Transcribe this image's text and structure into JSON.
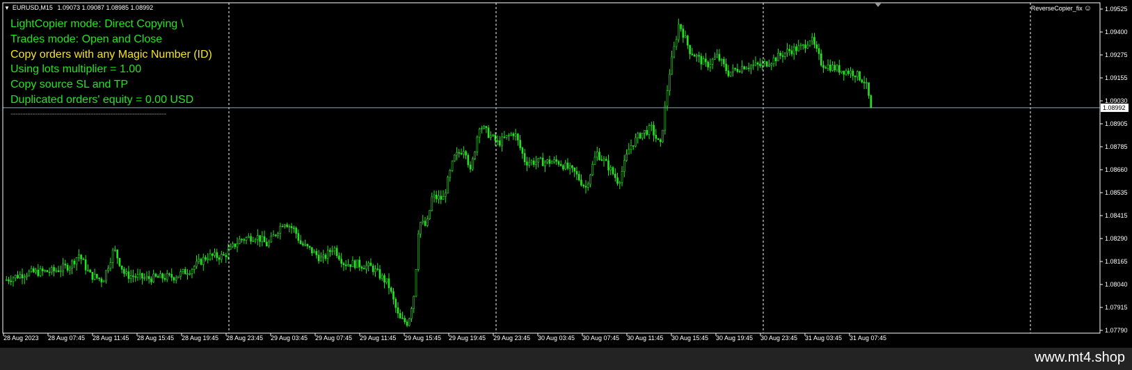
{
  "header": {
    "symbol": "EURUSD,M15",
    "ohlc": "1.09073 1.09087 1.08985 1.08992"
  },
  "overlay": {
    "lines": [
      {
        "text": "LightCopier mode: Direct Copying \\",
        "color": "green"
      },
      {
        "text": "Trades mode: Open and Close",
        "color": "green"
      },
      {
        "text": "Copy orders with any Magic Number (ID)",
        "color": "yellow"
      },
      {
        "text": "Using lots multiplier = 1.00",
        "color": "green"
      },
      {
        "text": "Copy source SL and TP",
        "color": "green"
      },
      {
        "text": "Duplicated orders' equity = 0.00 USD",
        "color": "green"
      }
    ],
    "separator": "----------------------------------------------------------------"
  },
  "expert": {
    "name": "ReverseCopier_fix",
    "icon": "smiley-icon"
  },
  "watermark": "www.mt4.shop",
  "colors": {
    "background": "#000000",
    "candle": "#22e61e",
    "grid": "#ffffff",
    "price_line": "#8fa8b8"
  },
  "chart_data": {
    "type": "candlestick",
    "current_price": "1.08992",
    "y_ticks": [
      "1.09525",
      "1.09400",
      "1.09275",
      "1.09155",
      "1.09030",
      "1.08905",
      "1.08785",
      "1.08660",
      "1.08535",
      "1.08415",
      "1.08290",
      "1.08165",
      "1.08040",
      "1.07915",
      "1.07790"
    ],
    "ylim": [
      1.0779,
      1.09525
    ],
    "x_ticks": [
      "28 Aug 2023",
      "28 Aug 07:45",
      "28 Aug 11:45",
      "28 Aug 15:45",
      "28 Aug 19:45",
      "28 Aug 23:45",
      "29 Aug 03:45",
      "29 Aug 07:45",
      "29 Aug 11:45",
      "29 Aug 15:45",
      "29 Aug 19:45",
      "29 Aug 23:45",
      "30 Aug 03:45",
      "30 Aug 07:45",
      "30 Aug 11:45",
      "30 Aug 15:45",
      "30 Aug 19:45",
      "30 Aug 23:45",
      "31 Aug 03:45",
      "31 Aug 07:45"
    ],
    "day_separators": 5,
    "close_path": [
      [
        0,
        1.0806
      ],
      [
        0.02,
        1.081
      ],
      [
        0.045,
        1.0811
      ],
      [
        0.06,
        1.0814
      ],
      [
        0.068,
        1.082
      ],
      [
        0.078,
        1.0809
      ],
      [
        0.09,
        1.0806
      ],
      [
        0.1,
        1.0823
      ],
      [
        0.11,
        1.0809
      ],
      [
        0.13,
        1.0807
      ],
      [
        0.155,
        1.0808
      ],
      [
        0.17,
        1.0812
      ],
      [
        0.185,
        1.0819
      ],
      [
        0.2,
        1.0819
      ],
      [
        0.215,
        1.0828
      ],
      [
        0.23,
        1.083
      ],
      [
        0.24,
        1.0825
      ],
      [
        0.255,
        1.0838
      ],
      [
        0.265,
        1.0833
      ],
      [
        0.27,
        1.0826
      ],
      [
        0.28,
        1.0822
      ],
      [
        0.29,
        1.0817
      ],
      [
        0.3,
        1.0824
      ],
      [
        0.31,
        1.0815
      ],
      [
        0.32,
        1.0815
      ],
      [
        0.335,
        1.0813
      ],
      [
        0.35,
        1.0804
      ],
      [
        0.36,
        1.0785
      ],
      [
        0.368,
        1.0783
      ],
      [
        0.374,
        1.08
      ],
      [
        0.378,
        1.0838
      ],
      [
        0.385,
        1.0835
      ],
      [
        0.39,
        1.0851
      ],
      [
        0.4,
        1.085
      ],
      [
        0.41,
        1.0872
      ],
      [
        0.42,
        1.0878
      ],
      [
        0.425,
        1.0864
      ],
      [
        0.433,
        1.089
      ],
      [
        0.45,
        1.088
      ],
      [
        0.465,
        1.0886
      ],
      [
        0.475,
        1.087
      ],
      [
        0.49,
        1.087
      ],
      [
        0.505,
        1.087
      ],
      [
        0.52,
        1.0864
      ],
      [
        0.53,
        1.0856
      ],
      [
        0.54,
        1.0875
      ],
      [
        0.55,
        1.0868
      ],
      [
        0.56,
        1.0859
      ],
      [
        0.57,
        1.0878
      ],
      [
        0.58,
        1.0885
      ],
      [
        0.59,
        1.0888
      ],
      [
        0.598,
        1.0878
      ],
      [
        0.606,
        1.0917
      ],
      [
        0.615,
        1.0945
      ],
      [
        0.625,
        1.093
      ],
      [
        0.64,
        1.0922
      ],
      [
        0.65,
        1.0927
      ],
      [
        0.66,
        1.0918
      ],
      [
        0.675,
        1.0922
      ],
      [
        0.69,
        1.0922
      ],
      [
        0.7,
        1.0925
      ],
      [
        0.715,
        1.093
      ],
      [
        0.728,
        1.0932
      ],
      [
        0.735,
        1.0937
      ],
      [
        0.745,
        1.0923
      ],
      [
        0.76,
        1.092
      ],
      [
        0.775,
        1.0918
      ],
      [
        0.785,
        1.0913
      ],
      [
        0.79,
        1.08992
      ]
    ]
  }
}
